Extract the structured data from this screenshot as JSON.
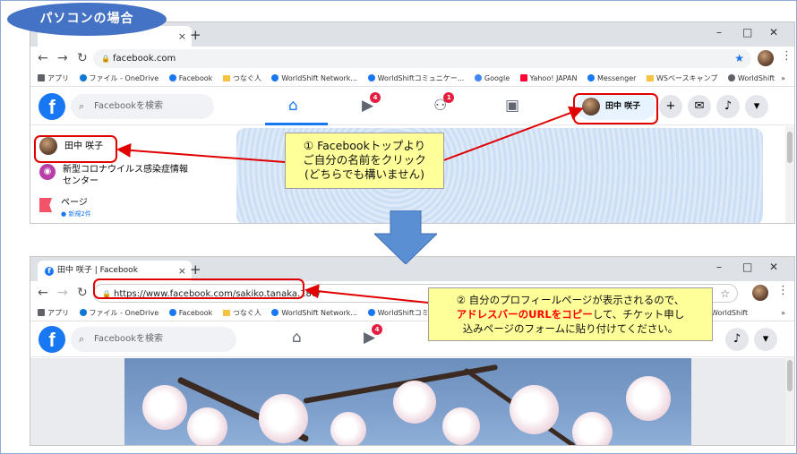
{
  "title_badge": "パソコンの場合",
  "top": {
    "tab_close": "×",
    "new_tab": "+",
    "win_min": "–",
    "win_max": "□",
    "win_close": "✕",
    "url": "facebook.com",
    "bookmarks": [
      "アプリ",
      "ファイル - OneDrive",
      "Facebook",
      "つなぐ人",
      "WorldShift Network...",
      "WorldShiftコミュニケー...",
      "Google",
      "Yahoo! JAPAN",
      "Messenger",
      "WSベースキャンプ",
      "WorldShift"
    ],
    "bookmarks_more": "»",
    "search_placeholder": "Facebookを検索",
    "badge_video": "4",
    "badge_groups": "1",
    "profile_name": "田中 咲子",
    "sidebar": {
      "profile": "田中 咲子",
      "covid_line1": "新型コロナウイルス感染症情報",
      "covid_line2": "センター",
      "pages": "ページ",
      "pages_sub": "● 新規2件"
    }
  },
  "bottom": {
    "tab_title": "田中 咲子 | Facebook",
    "tab_close": "×",
    "new_tab": "+",
    "url": "https://www.facebook.com/sakiko.tanaka.186/",
    "bookmarks": [
      "アプリ",
      "ファイル - OneDrive",
      "Facebook",
      "つなぐ人",
      "WorldShift Network...",
      "WorldShiftコミュニケー..."
    ],
    "bookmarks_tail": "WorldShift",
    "bookmarks_more": "»",
    "search_placeholder": "Facebookを検索",
    "badge_video": "4"
  },
  "callout1": {
    "line1": "① Facebookトップより",
    "line2": "ご自分の名前をクリック",
    "line3": "(どちらでも構いません)"
  },
  "callout2": {
    "line1": "② 自分のプロフィールページが表示されるので、",
    "line2_red": "アドレスバーのURLをコピー",
    "line2_rest": "して、チケット申し",
    "line3": "込みページのフォームに貼り付けてください。"
  },
  "colors": {
    "accent": "#4472c4",
    "facebook": "#1877f2",
    "highlight": "#e00000",
    "callout": "#ffff99"
  }
}
